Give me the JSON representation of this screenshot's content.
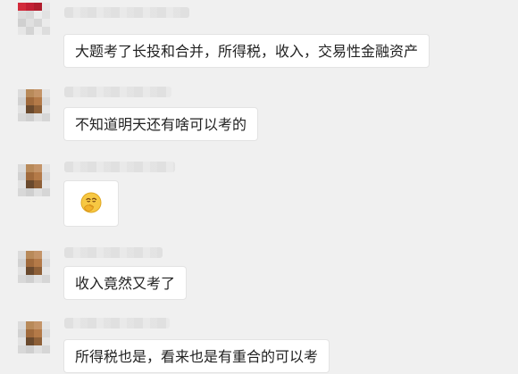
{
  "chat": {
    "messages": [
      {
        "type": "text",
        "text": "大题考了长投和合并，所得税，收入，交易性金融资产"
      },
      {
        "type": "text",
        "text": "不知道明天还有啥可以考的"
      },
      {
        "type": "emoji",
        "emoji_name": "thinking-face-icon"
      },
      {
        "type": "text",
        "text": "收入竟然又考了"
      },
      {
        "type": "text",
        "text": "所得税也是，看来也是有重合的可以考"
      }
    ]
  },
  "colors": {
    "background": "#f0f0f0",
    "bubble": "#ffffff",
    "text": "#222222"
  }
}
